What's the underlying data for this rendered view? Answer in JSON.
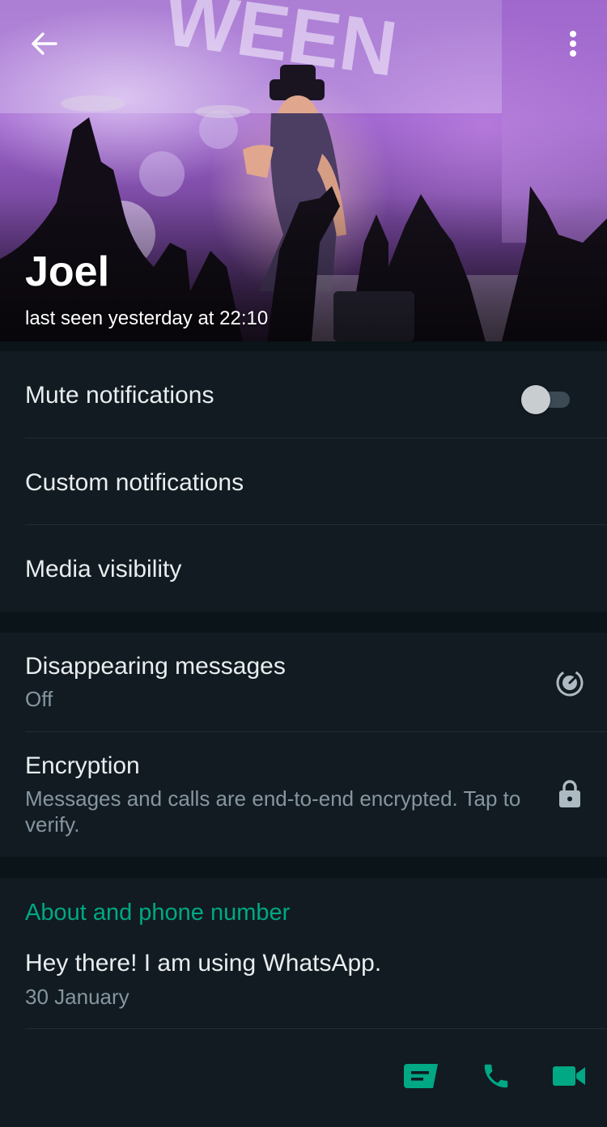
{
  "header": {
    "contact_name": "Joel",
    "last_seen": "last seen yesterday at 22:10",
    "back_icon": "arrow-left-icon",
    "more_icon": "more-vertical-icon",
    "photo_banner_text": "WEEN"
  },
  "settings": {
    "mute": {
      "label": "Mute notifications",
      "enabled": false
    },
    "custom_notifications": {
      "label": "Custom notifications"
    },
    "media_visibility": {
      "label": "Media visibility"
    }
  },
  "privacy": {
    "disappearing": {
      "label": "Disappearing messages",
      "value": "Off",
      "icon": "timer-icon"
    },
    "encryption": {
      "label": "Encryption",
      "description": "Messages and calls are end-to-end encrypted. Tap to verify.",
      "icon": "lock-icon"
    }
  },
  "about": {
    "section_title": "About and phone number",
    "status": "Hey there! I am using WhatsApp.",
    "date": "30 January"
  },
  "actions": [
    {
      "name": "message",
      "icon": "message-icon"
    },
    {
      "name": "voice-call",
      "icon": "phone-icon"
    },
    {
      "name": "video-call",
      "icon": "video-icon"
    }
  ],
  "colors": {
    "accent": "#00a884",
    "background": "#0b1418",
    "card": "#111b21",
    "primary_text": "#e9edef",
    "secondary_text": "#8696a0"
  }
}
